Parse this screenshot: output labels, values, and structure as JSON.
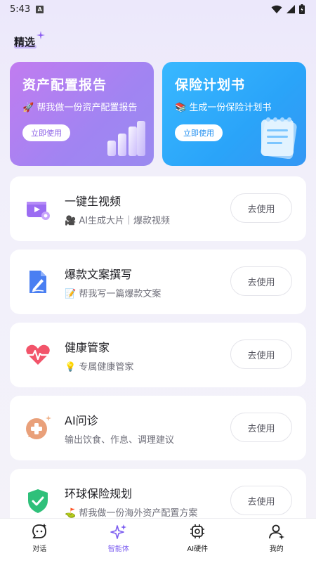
{
  "status": {
    "time": "5:43"
  },
  "header": {
    "title": "精选"
  },
  "hero": [
    {
      "title": "资产配置报告",
      "subtitle": "🚀 帮我做一份资产配置报告",
      "button": "立即使用"
    },
    {
      "title": "保险计划书",
      "subtitle": "📚 生成一份保险计划书",
      "button": "立即使用"
    }
  ],
  "list": [
    {
      "title": "一键生视频",
      "subtitle": "🎥 AI生成大片｜爆款视频",
      "button": "去使用",
      "icon": "video-icon"
    },
    {
      "title": "爆款文案撰写",
      "subtitle": "📝 帮我写一篇爆款文案",
      "button": "去使用",
      "icon": "document-pen-icon"
    },
    {
      "title": "健康管家",
      "subtitle": "💡 专属健康管家",
      "button": "去使用",
      "icon": "heartbeat-icon"
    },
    {
      "title": "AI问诊",
      "subtitle": "输出饮食、作息、调理建议",
      "button": "去使用",
      "icon": "medical-chat-icon"
    },
    {
      "title": "环球保险规划",
      "subtitle": "⛳ 帮我做一份海外资产配置方案",
      "button": "去使用",
      "icon": "shield-check-icon"
    }
  ],
  "tabs": [
    {
      "label": "对话",
      "icon": "chat-icon",
      "active": false
    },
    {
      "label": "智能体",
      "icon": "sparkle-icon",
      "active": true
    },
    {
      "label": "AI硬件",
      "icon": "chip-icon",
      "active": false
    },
    {
      "label": "我的",
      "icon": "profile-icon",
      "active": false
    }
  ],
  "colors": {
    "accent": "#7b5cf0",
    "hero_purple": "#b07ef1",
    "hero_blue": "#2aa4f9"
  }
}
